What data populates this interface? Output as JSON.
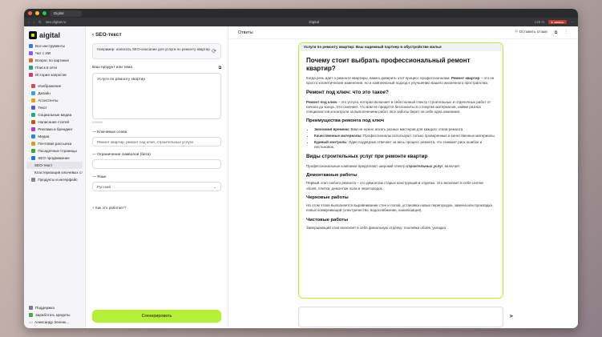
{
  "browser": {
    "tab": "Digital",
    "url": "seo.digital.ru",
    "title": "Digital",
    "zoom": "125 %",
    "rec": "● запись"
  },
  "brand": {
    "name": "aigital"
  },
  "sidebar": {
    "top": [
      "Все инструменты",
      "Чат с ИИ",
      "Вопрос по картинке",
      "Поиск в сети",
      "История запросов"
    ],
    "groups": [
      "Изображение",
      "Дизайн",
      "Ассистенты",
      "Текст",
      "Социальные медиа",
      "Написание статей",
      "Реклама и брендинг",
      "Медиа",
      "Почтовая рассылка",
      "Посадочные страницы",
      "SEO продвижение"
    ],
    "sub": [
      "SEO-текст",
      "Кластеризация ключевых слов"
    ],
    "last": "Продукты и интерфейс",
    "bottom": [
      "Поддержка",
      "Заработать кредиты"
    ],
    "user_initials": "АЗ",
    "user": "Александр Зеленк..."
  },
  "form": {
    "back": "‹  SEO-текст",
    "example": "Например: написать SEO-описание для услуги по ремонту квартир",
    "topic_label": "Ваш продукт или тема",
    "topic_value": "Услуги по ремонту квартир",
    "counter": "21/5000",
    "kw_label": "Ключевые слова",
    "kw_value": "Ремонт квартир, ремонт под ключ, строительные услуги",
    "limit_label": "Ограничение символов (бета)",
    "lang_label": "Язык",
    "lang_value": "Русский",
    "how": "Как это работает?",
    "generate": "Сгенерировать"
  },
  "main": {
    "title": "Ответы",
    "feedback": "Оставить отзыв"
  },
  "answer": {
    "header": "Услуги по ремонту квартир: Ваш надежный партнер в обустройстве жилья",
    "h1": "Почему стоит выбрать профессиональный ремонт квартир?",
    "p1a": "Когда речь идет о ремонте квартиры, важно доверить этот процесс профессионалам.",
    "p1b": "Ремонт квартир",
    "p1c": " – это не просто косметические изменения, но и комплексный подход к улучшению вашего жизненного пространства.",
    "h2a": "Ремонт под ключ: что это такое?",
    "p2a": "Ремонт под ключ",
    "p2b": " – это услуга, которая включает в себя полный спектр строительных и отделочных работ от начала до конца. Это означает, что вам не придется беспокоиться о покупке материалов, найме разных специалистов и контроле за выполнением работ. Все заботы берет на себя одна компания.",
    "h3a": "Преимущества ремонта под ключ",
    "li": [
      {
        "b": "Экономия времени:",
        "t": " Вам не нужно искать разных мастеров для каждого этапа ремонта."
      },
      {
        "b": "Качественные материалы:",
        "t": " Профессионалы используют только проверенные и качественные материалы."
      },
      {
        "b": "Единый контроль:",
        "t": " Один подрядчик отвечает за весь процесс ремонта, что снижает риск ошибок и нестыковок."
      }
    ],
    "h2b": "Виды строительных услуг при ремонте квартир",
    "p3a": "Профессиональные компании предлагают широкий спектр ",
    "p3b": "строительных услуг",
    "p3c": ", включая:",
    "h3b": "Демонтажные работы",
    "p4": "Первый этап любого ремонта – это демонтаж старых конструкций и отделки. Это включает в себя снятие обоев, плитки, демонтаж пола и перегородок.",
    "h3c": "Черновые работы",
    "p5": "На этом этапе выполняется выравнивание стен и полов, установка новых перегородок, замена или прокладка новых коммуникаций (электричество, водоснабжение, канализация).",
    "h3d": "Чистовые работы",
    "p6": "Завершающий этап включает в себя финальную отделку: поклейка обоев, укладка"
  }
}
